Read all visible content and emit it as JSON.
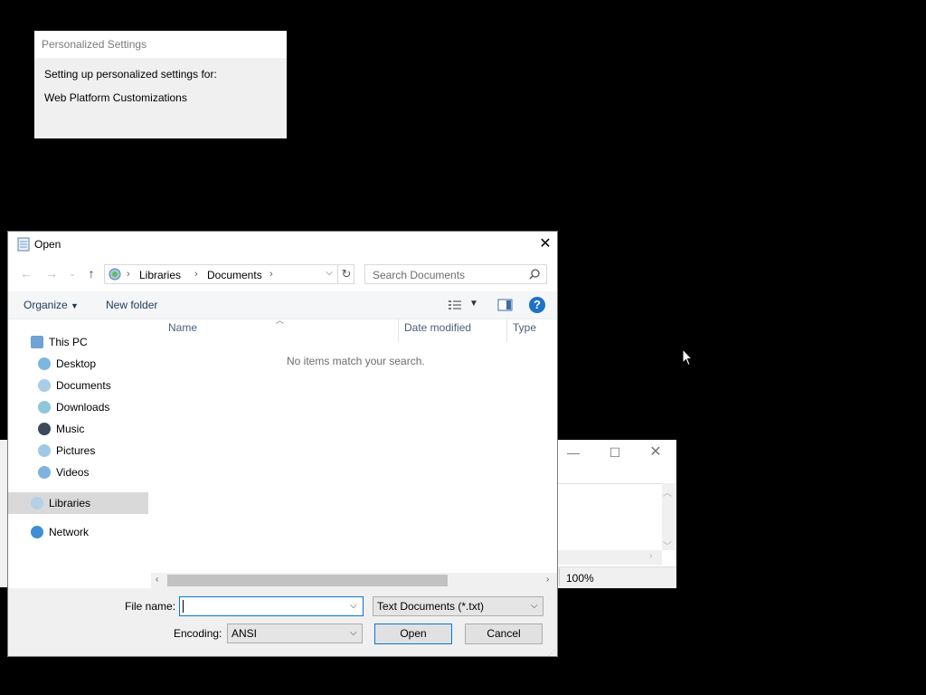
{
  "personalized_settings": {
    "title": "Personalized Settings",
    "line1": "Setting up personalized settings for:",
    "line2": "Web Platform Customizations"
  },
  "notepad": {
    "zoom": "100%"
  },
  "dialog": {
    "title": "Open",
    "address": {
      "crumbs": [
        "Libraries",
        "Documents"
      ]
    },
    "search_placeholder": "Search Documents",
    "toolbar": {
      "organize": "Organize",
      "new_folder": "New folder"
    },
    "nav": {
      "this_pc": "This PC",
      "items": [
        "Desktop",
        "Documents",
        "Downloads",
        "Music",
        "Pictures",
        "Videos"
      ],
      "libraries": "Libraries",
      "network": "Network"
    },
    "columns": {
      "name": "Name",
      "date_modified": "Date modified",
      "type": "Type"
    },
    "empty_message": "No items match your search.",
    "file_name_label": "File name:",
    "file_name_value": "",
    "file_type": "Text Documents (*.txt)",
    "encoding_label": "Encoding:",
    "encoding": "ANSI",
    "open_button": "Open",
    "cancel_button": "Cancel"
  },
  "colors": {
    "accent": "#0078d7",
    "help": "#1a72c9",
    "selection": "#d9d9d9"
  },
  "icons": [
    "notepad-icon",
    "back-arrow-icon",
    "forward-arrow-icon",
    "up-arrow-icon",
    "library-icon",
    "refresh-icon",
    "search-icon",
    "view-options-icon",
    "preview-pane-icon",
    "help-icon",
    "close-icon",
    "minimize-icon",
    "maximize-icon"
  ]
}
